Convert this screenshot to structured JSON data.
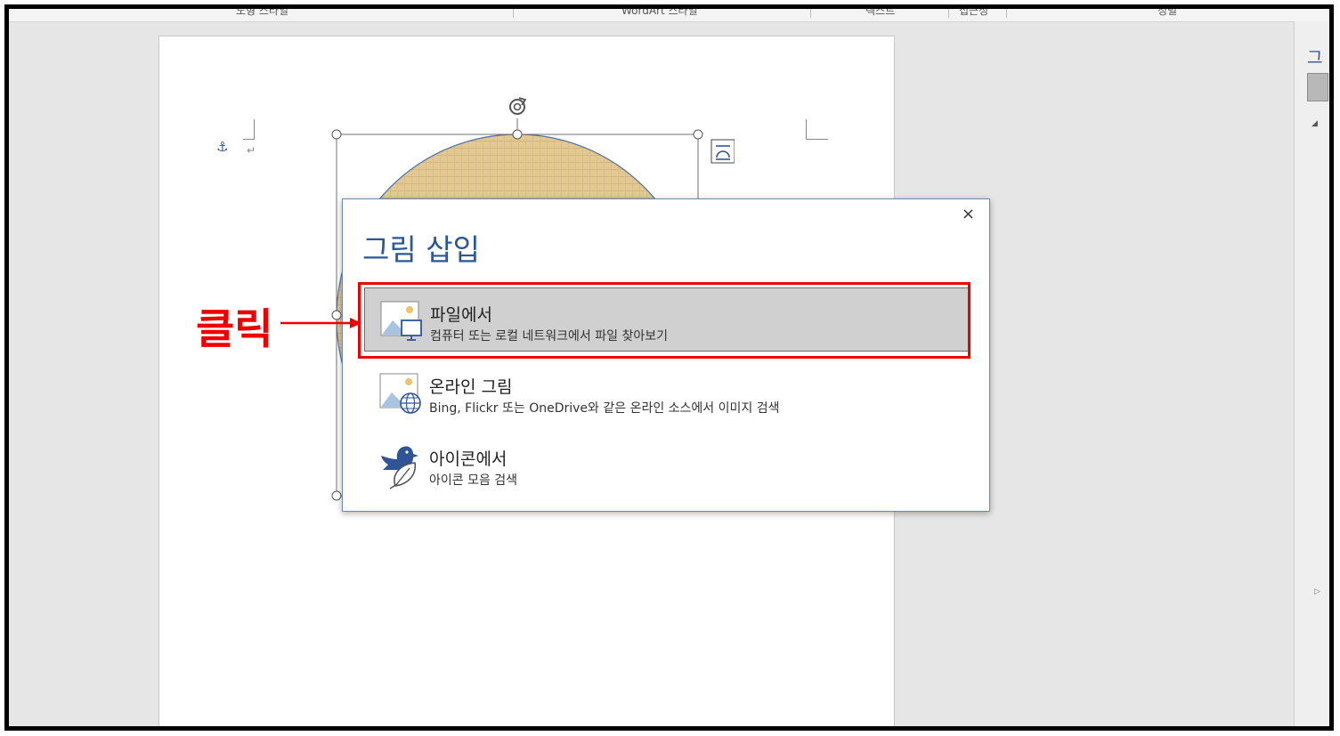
{
  "ribbon": {
    "groups": [
      {
        "label": "도형 스타일"
      },
      {
        "label": "WordArt 스타일"
      },
      {
        "label": "텍스트"
      },
      {
        "label": "접근성"
      },
      {
        "label": "정렬"
      }
    ]
  },
  "right_pane": {
    "title": "그"
  },
  "dialog": {
    "title": "그림 삽입",
    "close_glyph": "×",
    "options": [
      {
        "title": "파일에서",
        "description": "컴퓨터 또는 로컬 네트워크에서 파일 찾아보기",
        "icon": "picture-from-file-icon",
        "selected": true
      },
      {
        "title": "온라인 그림",
        "description": "Bing, Flickr 또는 OneDrive와 같은 온라인 소스에서 이미지 검색",
        "icon": "online-picture-icon",
        "selected": false
      },
      {
        "title": "아이콘에서",
        "description": "아이콘 모음 검색",
        "icon": "icons-bird-leaf-icon",
        "selected": false
      }
    ]
  },
  "annotation": {
    "text": "클릭",
    "color": "#ee0000"
  },
  "colors": {
    "accent": "#2b579a",
    "highlight": "#ee0000",
    "shape_fill": "#e2c894"
  }
}
